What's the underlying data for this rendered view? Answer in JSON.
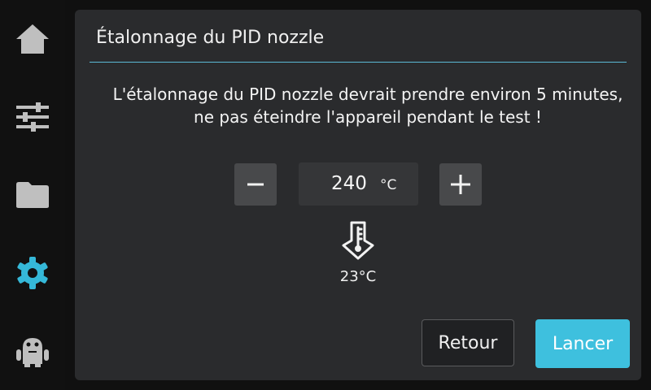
{
  "sidebar": {
    "items": [
      {
        "icon": "home-icon",
        "active": false
      },
      {
        "icon": "sliders-icon",
        "active": false
      },
      {
        "icon": "folder-icon",
        "active": false
      },
      {
        "icon": "gear-icon",
        "active": true
      },
      {
        "icon": "robot-icon",
        "active": false
      }
    ],
    "icon_color": "#bfbfbf",
    "active_color": "#35b8d8"
  },
  "dialog": {
    "title": "Étalonnage du PID nozzle",
    "message": "L'étalonnage du PID nozzle devrait prendre environ 5 minutes, ne pas éteindre l'appareil pendant le test !",
    "target_temp": "240",
    "temp_unit": "°C",
    "current_temp": "23°C",
    "back_label": "Retour",
    "start_label": "Lancer"
  },
  "colors": {
    "accent": "#3ec0de",
    "panel": "#2a2b2d"
  }
}
